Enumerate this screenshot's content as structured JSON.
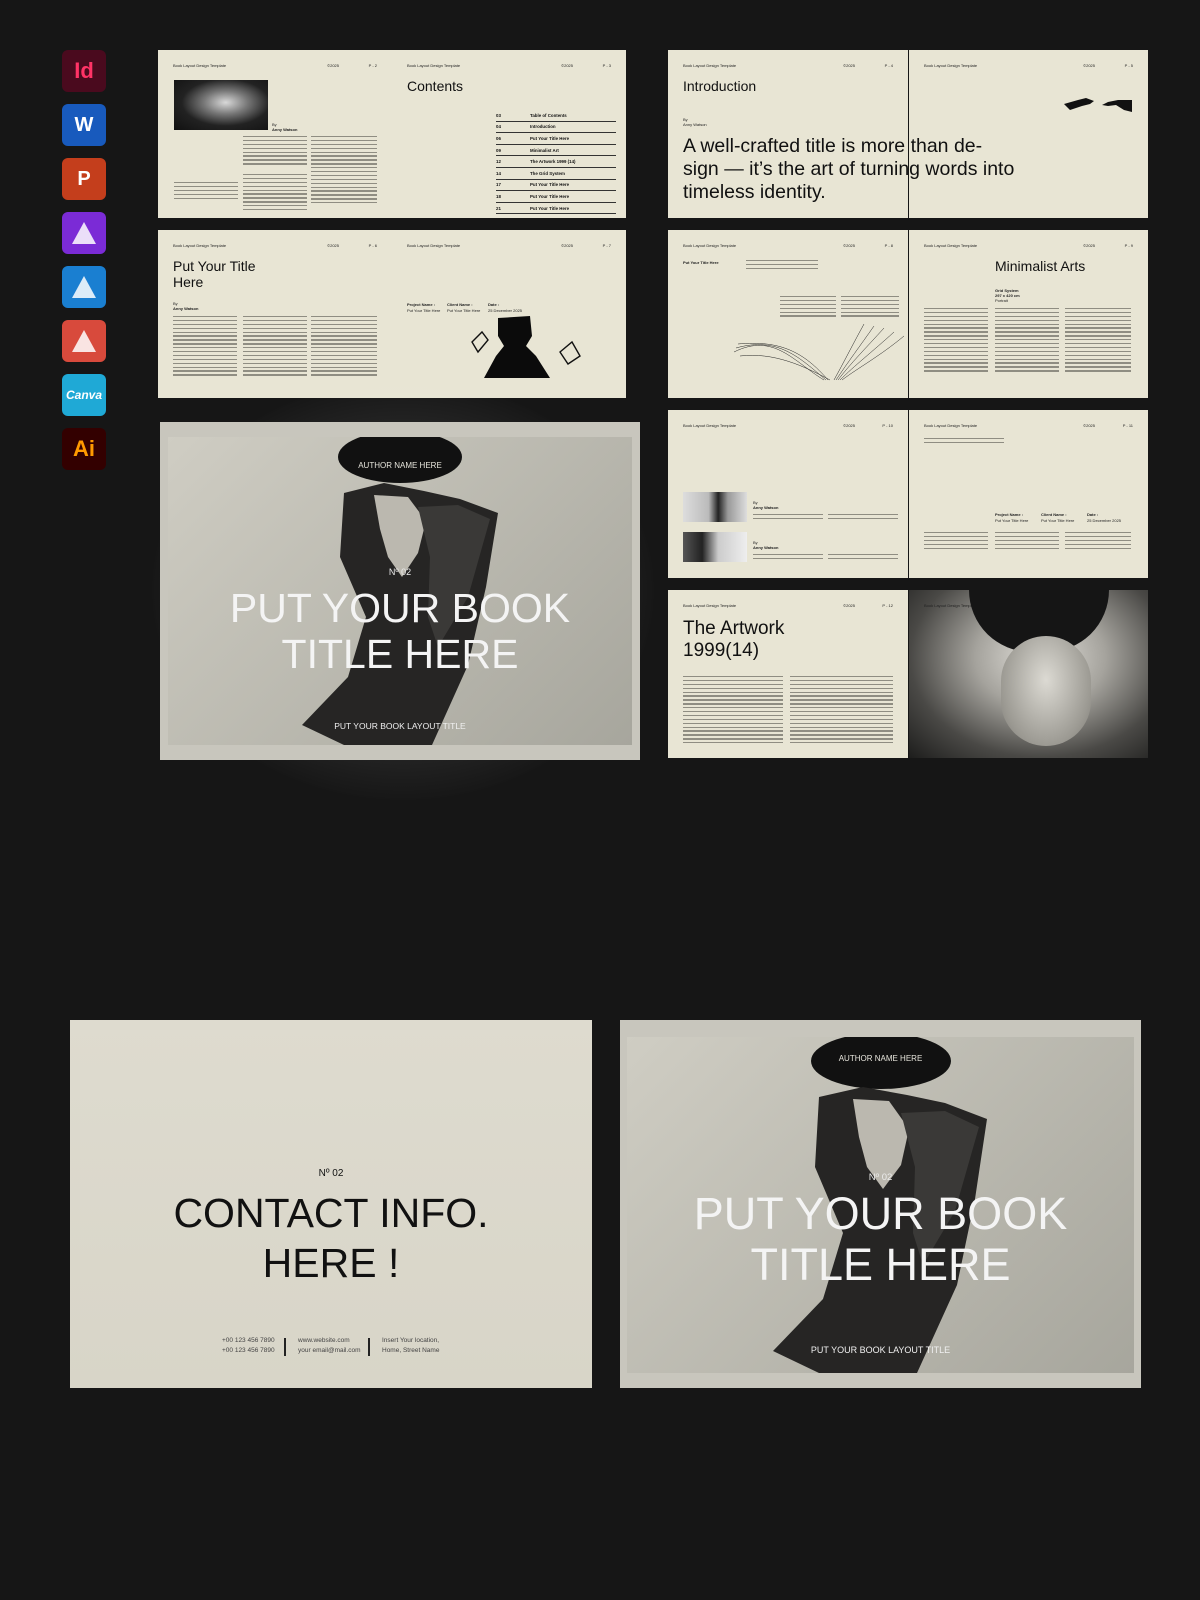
{
  "app_icons": [
    {
      "name": "indesign-icon",
      "label": "Id",
      "bg": "#4a0a1e",
      "fg": "#ff3366"
    },
    {
      "name": "word-icon",
      "label": "W",
      "bg": "#185abd",
      "fg": "#ffffff"
    },
    {
      "name": "powerpoint-icon",
      "label": "P",
      "bg": "#c43e1c",
      "fg": "#ffffff"
    },
    {
      "name": "affinity-publisher-icon",
      "label": "",
      "bg": "#7b2bd6",
      "fg": "#ffffff"
    },
    {
      "name": "affinity-designer-icon",
      "label": "",
      "bg": "#1a7fd1",
      "fg": "#ffffff"
    },
    {
      "name": "affinity-photo-icon",
      "label": "",
      "bg": "#d84a3c",
      "fg": "#ffffff"
    },
    {
      "name": "canva-icon",
      "label": "Canva",
      "bg": "#1fa9d6",
      "fg": "#ffffff"
    },
    {
      "name": "illustrator-icon",
      "label": "Ai",
      "bg": "#330000",
      "fg": "#ff9a00"
    }
  ],
  "spread_header": {
    "left": "Book Layout Design Template",
    "year": "©2025"
  },
  "pages": {
    "p2": {
      "num": "P - 2",
      "by": "By",
      "author": "Anny Watson"
    },
    "p3": {
      "num": "P - 3",
      "title": "Contents",
      "toc": [
        [
          "03",
          "Table of Contents"
        ],
        [
          "04",
          "Introduction"
        ],
        [
          "06",
          "Put Your Title Here"
        ],
        [
          "09",
          "Minimalist Art"
        ],
        [
          "12",
          "The Artwork 1999 (14)"
        ],
        [
          "14",
          "The Grid System"
        ],
        [
          "17",
          "Put Your Title Here"
        ],
        [
          "18",
          "Put Your Title Here"
        ],
        [
          "21",
          "Put Your Title Here"
        ]
      ]
    },
    "p4": {
      "num": "P - 4",
      "title": "Introduction",
      "by": "By",
      "author": "Anny Watson",
      "quote_1": "A well-crafted title is more than de-",
      "quote_2": "sign — it’s the art of turning words into",
      "quote_3": "timeless identity."
    },
    "p5": {
      "num": "P - 5"
    },
    "p6": {
      "num": "P - 6",
      "title_1": "Put Your Title",
      "title_2": "Here",
      "by": "By",
      "author": "Anny Watson"
    },
    "p7": {
      "num": "P - 7",
      "col1_h": "Project Name :",
      "col1_v": "Put Your Title Here",
      "col2_h": "Client Name :",
      "col2_v": "Put Your Title Here",
      "col3_h": "Date :",
      "col3_v": "25 December 2025"
    },
    "p8": {
      "num": "P - 8",
      "title": "Put Your Title Here"
    },
    "p9": {
      "num": "P - 9",
      "title": "Minimalist Arts",
      "grid_1": "Grid System",
      "grid_2": "297 x 420 cm",
      "grid_3": "Portrait"
    },
    "p10": {
      "num": "P - 10",
      "by": "By",
      "author": "Anny Watson"
    },
    "p11": {
      "num": "P - 11",
      "col1_h": "Project Name :",
      "col1_v": "Put Your Title Here",
      "col2_h": "Client Name :",
      "col2_v": "Put Your Title Here",
      "col3_h": "Date :",
      "col3_v": "25 December 2025"
    },
    "p12": {
      "num": "P - 12",
      "title_1": "The Artwork",
      "title_2": "1999(14)"
    }
  },
  "cover": {
    "author": "AUTHOR NAME HERE",
    "no": "Nº 02",
    "title_1": "PUT YOUR BOOK",
    "title_2": "TITLE HERE",
    "subtitle": "PUT YOUR BOOK LAYOUT TITLE"
  },
  "contact": {
    "no": "Nº 02",
    "title_1": "CONTACT INFO.",
    "title_2": "HERE !",
    "phone_1": "+00 123 456 7890",
    "phone_2": "+00 123 456 7890",
    "web": "www.website.com",
    "email": "your email@mail.com",
    "addr_1": "Insert Your location,",
    "addr_2": "Home, Street Name"
  }
}
